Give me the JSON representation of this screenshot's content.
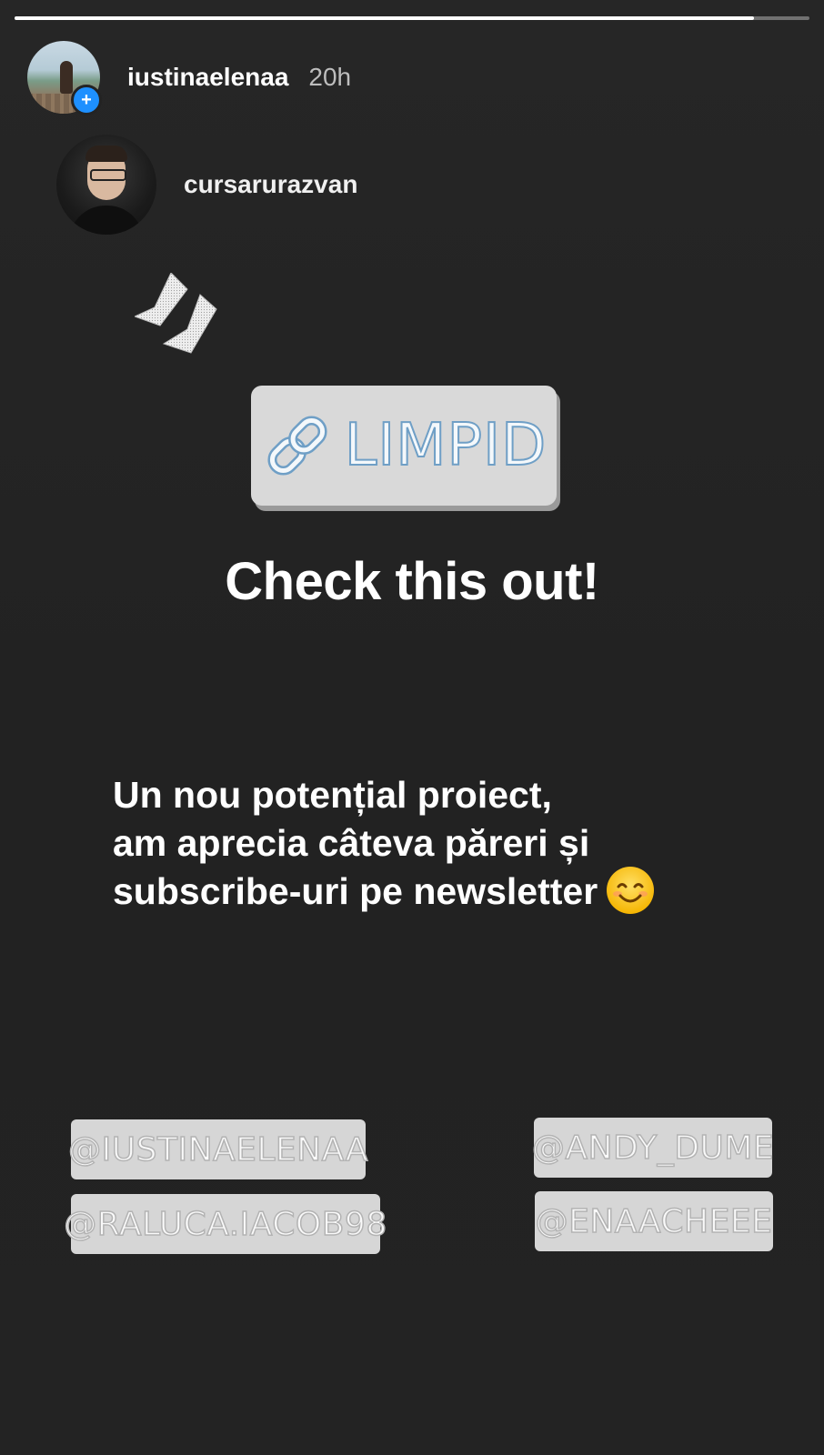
{
  "story": {
    "progress_fraction": 0.93,
    "author": {
      "username": "iustinaelenaa",
      "time": "20h",
      "badge": "+"
    },
    "shared_post": {
      "username": "cursarurazvan"
    },
    "link_sticker": {
      "label": "LIMPID",
      "icon": "link-icon"
    },
    "headline": "Check this out!",
    "body_lines": [
      "Un nou potențial proiect,",
      "am aprecia câteva păreri și",
      "subscribe-uri pe newsletter"
    ],
    "body_emoji": "smiling-face-emoji",
    "mentions": {
      "left": [
        "@IUSTINAELENAA",
        "@RALUCA.IACOB98"
      ],
      "right": [
        "@ANDY_DUME",
        "@ENAACHEEE"
      ]
    }
  },
  "colors": {
    "background": "#232323",
    "link_text_outline": "#6f9fc6",
    "badge_blue": "#1e90ff",
    "sticker_bg": "#d9d9d9"
  }
}
